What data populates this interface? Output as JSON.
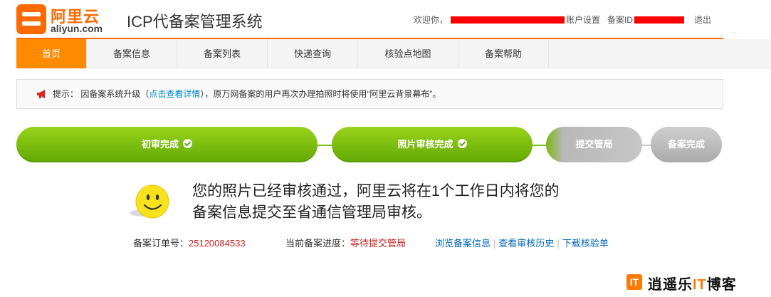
{
  "header": {
    "logo_cn": "阿里云",
    "logo_en": "aliyun.com",
    "system_title": "ICP代备案管理系统",
    "welcome": "欢迎你，",
    "account_settings": "账户设置",
    "filing_id_label": "备案ID",
    "logout": "退出"
  },
  "nav": {
    "items": [
      {
        "label": "首页",
        "active": true
      },
      {
        "label": "备案信息",
        "active": false
      },
      {
        "label": "备案列表",
        "active": false
      },
      {
        "label": "快递查询",
        "active": false
      },
      {
        "label": "核验点地图",
        "active": false
      },
      {
        "label": "备案帮助",
        "active": false
      }
    ]
  },
  "notice": {
    "prefix": "提示： 因备案系统升级（",
    "link": "点击查看详情",
    "suffix": "），原万网备案的用户再次办理拍照时将使用“阿里云背景幕布”。"
  },
  "progress": {
    "steps": [
      {
        "label": "初审完成",
        "status": "done"
      },
      {
        "label": "照片审核完成",
        "status": "done"
      },
      {
        "label": "提交管局",
        "status": "current"
      },
      {
        "label": "备案完成",
        "status": "pending"
      }
    ]
  },
  "message": {
    "line1": "您的照片已经审核通过，阿里云将在1个工作日内将您的",
    "line2": "备案信息提交至省通信管理局审核。"
  },
  "order": {
    "label": "备案订单号：",
    "value": "25120084533",
    "progress_label": "当前备案进度：",
    "progress_value": "等待提交管局"
  },
  "links": {
    "view_info": "浏览备案信息",
    "view_history": "查看审核历史",
    "download": "下载核验单"
  },
  "watermark": {
    "box": "IT",
    "prefix": "逍遥乐",
    "it": "IT",
    "suffix": "博客"
  },
  "colors": {
    "brand": "#ff6a00",
    "nav_active": "#ff8a00",
    "done_green": "#62a804",
    "link_blue": "#0066bb",
    "order_red": "#c81e1e"
  }
}
